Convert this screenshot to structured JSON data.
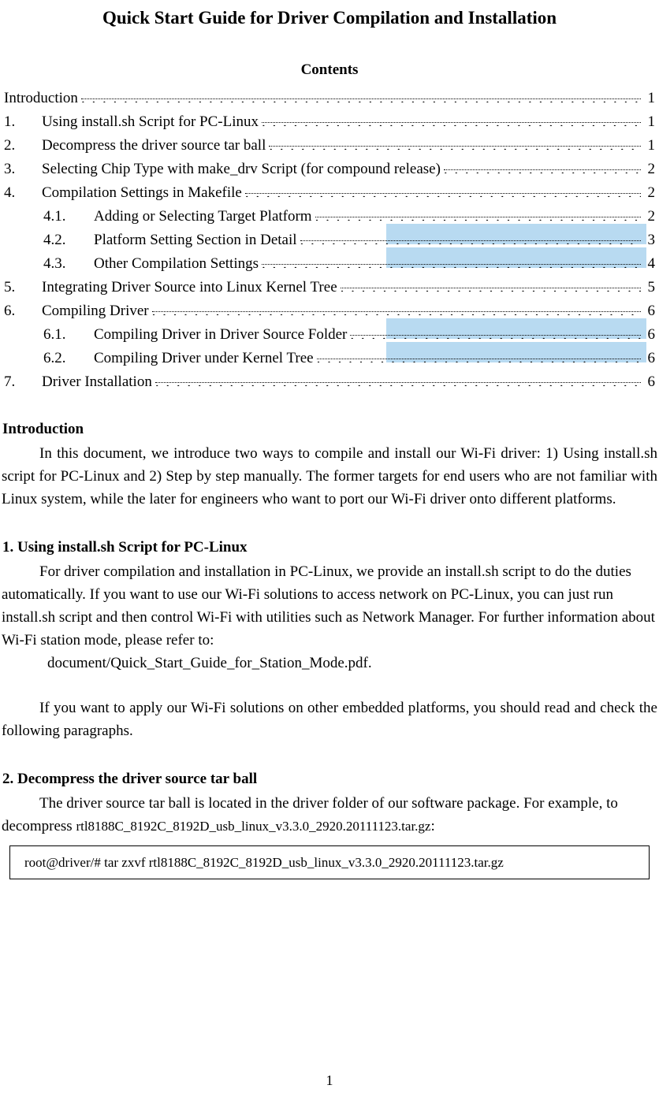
{
  "title": "Quick Start Guide for Driver Compilation and Installation",
  "contents_heading": "Contents",
  "toc": [
    {
      "num": "",
      "label": "Introduction",
      "page": "1",
      "sub": false,
      "variant": "nonum"
    },
    {
      "num": "1.",
      "label": "Using install.sh Script for PC-Linux",
      "page": "1",
      "sub": false
    },
    {
      "num": "2.",
      "label": "Decompress the driver source tar ball",
      "page": "1",
      "sub": false
    },
    {
      "num": "3.",
      "label": "Selecting Chip Type with make_drv Script (for compound release)",
      "page": "2",
      "sub": false
    },
    {
      "num": "4.",
      "label": "Compilation Settings in Makefile",
      "page": "2",
      "sub": false
    },
    {
      "num": "4.1.",
      "label": "Adding or Selecting Target Platform",
      "page": "2",
      "sub": true
    },
    {
      "num": "4.2.",
      "label": "Platform Setting Section in Detail",
      "page": "3",
      "sub": true
    },
    {
      "num": "4.3.",
      "label": "Other Compilation Settings",
      "page": "4",
      "sub": true
    },
    {
      "num": "5.",
      "label": "Integrating Driver Source into Linux Kernel Tree",
      "page": "5",
      "sub": false
    },
    {
      "num": "6.",
      "label": "Compiling Driver",
      "page": "6",
      "sub": false
    },
    {
      "num": "6.1.",
      "label": "Compiling Driver in Driver Source Folder",
      "page": "6",
      "sub": true
    },
    {
      "num": "6.2.",
      "label": "Compiling Driver under Kernel Tree",
      "page": "6",
      "sub": true
    },
    {
      "num": "7.",
      "label": "Driver Installation",
      "page": "6",
      "sub": false
    }
  ],
  "intro_heading": "Introduction",
  "intro_p1": "In this document, we introduce two ways to compile and install our Wi-Fi driver: 1) Using install.sh script for PC-Linux and 2) Step by step manually. The former targets for end users who are not familiar with Linux system, while the later for engineers who want to port our Wi-Fi driver onto different platforms.",
  "sec1_heading": "1.    Using install.sh Script for PC-Linux",
  "sec1_p1": "For driver compilation and installation in PC-Linux, we provide an install.sh script to do the duties automatically. If you want to use our Wi-Fi solutions to access network on PC-Linux, you can just run install.sh script and then control Wi-Fi with utilities such as Network Manager. For further information about Wi-Fi station mode, please refer to:",
  "sec1_ref": "document/Quick_Start_Guide_for_Station_Mode.pdf.",
  "sec1_p2": "If you want to apply our Wi-Fi solutions on other embedded platforms, you should read and check the following paragraphs.",
  "sec2_heading": "2.    Decompress the driver source tar ball",
  "sec2_p1a": "The driver source tar ball is located in the driver folder of our software package. For example, to decompress ",
  "sec2_fname": "rtl8188C_8192C_8192D_usb_linux_v3.3.0_2920.20111123.tar.gz",
  "sec2_p1b": ":",
  "code_cmd": "root@driver/# tar zxvf rtl8188C_8192C_8192D_usb_linux_v3.3.0_2920.20111123.tar.gz",
  "page_number": "1",
  "selection_highlight_color": "#b8daf1"
}
